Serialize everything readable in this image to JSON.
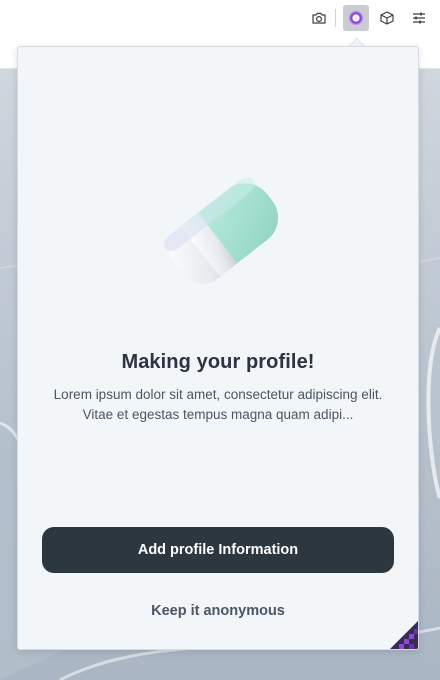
{
  "toolbar": {
    "buttons": [
      {
        "icon": "camera-icon"
      },
      {
        "icon": "extension-icon"
      },
      {
        "icon": "cube-icon"
      },
      {
        "icon": "sliders-icon"
      }
    ]
  },
  "popup": {
    "illustration": "eraser-icon",
    "title": "Making your profile!",
    "description": "Lorem ipsum dolor sit amet, consectetur adipiscing elit. Vitae et egestas tempus magna quam adipi...",
    "primary_button_label": "Add profile Information",
    "secondary_link_label": "Keep it anonymous"
  },
  "colors": {
    "popup_background": "#f3f6f9",
    "primary_button": "#2d3740",
    "eraser_mint": "#a9e3d3",
    "extension_accent": "#8a4bd8"
  }
}
